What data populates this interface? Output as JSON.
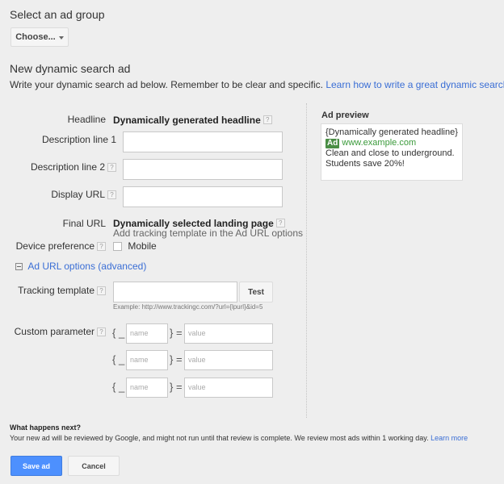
{
  "ad_group": {
    "heading": "Select an ad group",
    "dropdown_value": "Choose..."
  },
  "section": {
    "heading": "New dynamic search ad",
    "intro": "Write your dynamic search ad below. Remember to be clear and specific.",
    "intro_link": "Learn how to write a great dynamic search ad"
  },
  "form": {
    "headline_label": "Headline",
    "headline_value": "Dynamically generated headline",
    "desc1_label": "Description line 1",
    "desc1_value": "",
    "desc2_label": "Description line 2",
    "desc2_value": "",
    "display_url_label": "Display URL",
    "display_url_value": "",
    "final_url_label": "Final URL",
    "final_url_value": "Dynamically selected landing page",
    "final_url_hint": "Add tracking template in the Ad URL options",
    "device_label": "Device preference",
    "device_option": "Mobile",
    "device_checked": false,
    "help_glyph": "?"
  },
  "url_options": {
    "toggle_label": "Ad URL options (advanced)",
    "tracking_label": "Tracking template",
    "tracking_value": "",
    "test_button": "Test",
    "example": "Example: http://www.trackingc.com/?url={lpurl}&id=5",
    "custom_label": "Custom parameter",
    "open_brace": "{ _",
    "close_equals": "} =",
    "params": [
      {
        "name_placeholder": "name",
        "value_placeholder": "value"
      },
      {
        "name_placeholder": "name",
        "value_placeholder": "value"
      },
      {
        "name_placeholder": "name",
        "value_placeholder": "value"
      }
    ]
  },
  "preview": {
    "title": "Ad preview",
    "headline": "{Dynamically generated headline}",
    "badge": "Ad",
    "url": "www.example.com",
    "line1": "Clean and close to underground.",
    "line2": "Students save 20%!"
  },
  "footer": {
    "next_heading": "What happens next?",
    "next_text": "Your new ad will be reviewed by Google, and might not run until that review is complete. We review most ads within 1 working day.",
    "learn_more": "Learn more",
    "save_button": "Save ad",
    "cancel_button": "Cancel"
  },
  "colors": {
    "link": "#3a6ed5",
    "primary_button": "#4d90fe",
    "ad_badge": "#4a8e45",
    "display_url": "#3a9a3a"
  }
}
